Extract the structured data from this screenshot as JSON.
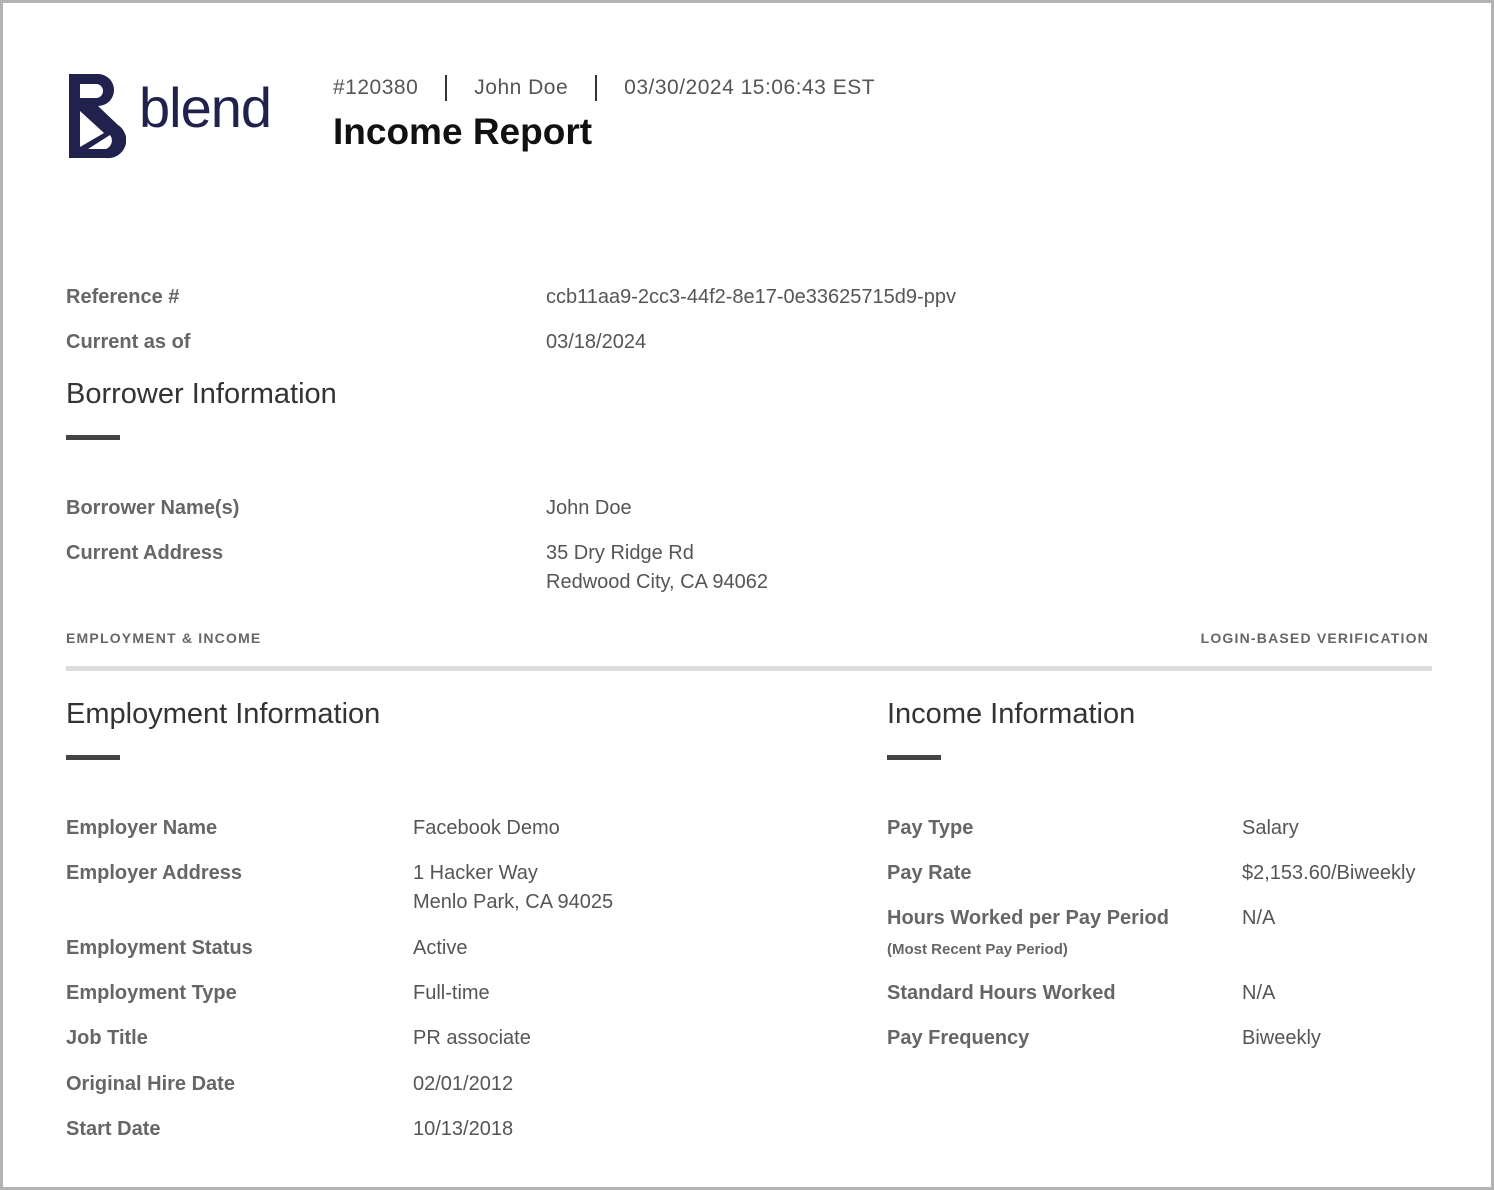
{
  "logo": {
    "text": "blend"
  },
  "header": {
    "report_number": "#120380",
    "borrower": "John Doe",
    "timestamp": "03/30/2024 15:06:43 EST",
    "title": "Income Report"
  },
  "reference": {
    "ref_label": "Reference #",
    "ref_value": "ccb11aa9-2cc3-44f2-8e17-0e33625715d9-ppv",
    "current_label": "Current as of",
    "current_value": "03/18/2024"
  },
  "borrower_info": {
    "title": "Borrower Information",
    "name_label": "Borrower Name(s)",
    "name_value": "John Doe",
    "address_label": "Current Address",
    "address_line1": "35 Dry Ridge Rd",
    "address_line2": "Redwood City, CA 94062"
  },
  "band": {
    "left": "EMPLOYMENT & INCOME",
    "right": "LOGIN-BASED VERIFICATION"
  },
  "employment": {
    "title": "Employment Information",
    "employer_name_label": "Employer Name",
    "employer_name": "Facebook Demo",
    "employer_address_label": "Employer Address",
    "employer_address_line1": "1 Hacker Way",
    "employer_address_line2": "Menlo Park, CA 94025",
    "status_label": "Employment Status",
    "status": "Active",
    "type_label": "Employment Type",
    "type": "Full-time",
    "job_title_label": "Job Title",
    "job_title": "PR associate",
    "hire_date_label": "Original Hire Date",
    "hire_date": "02/01/2012",
    "start_date_label": "Start Date",
    "start_date": "10/13/2018"
  },
  "income": {
    "title": "Income Information",
    "pay_type_label": "Pay Type",
    "pay_type": "Salary",
    "pay_rate_label": "Pay Rate",
    "pay_rate": "$2,153.60/Biweekly",
    "hours_label": "Hours Worked per Pay Period",
    "hours_sublabel": "(Most Recent Pay Period)",
    "hours": "N/A",
    "standard_hours_label": "Standard Hours Worked",
    "standard_hours": "N/A",
    "frequency_label": "Pay Frequency",
    "frequency": "Biweekly"
  },
  "colors": {
    "brand": "#20224d",
    "divider": "#dcdcdc",
    "accent_rule": "#444444"
  },
  "icons": {
    "logo_mark": "blend-b-logo-icon"
  }
}
